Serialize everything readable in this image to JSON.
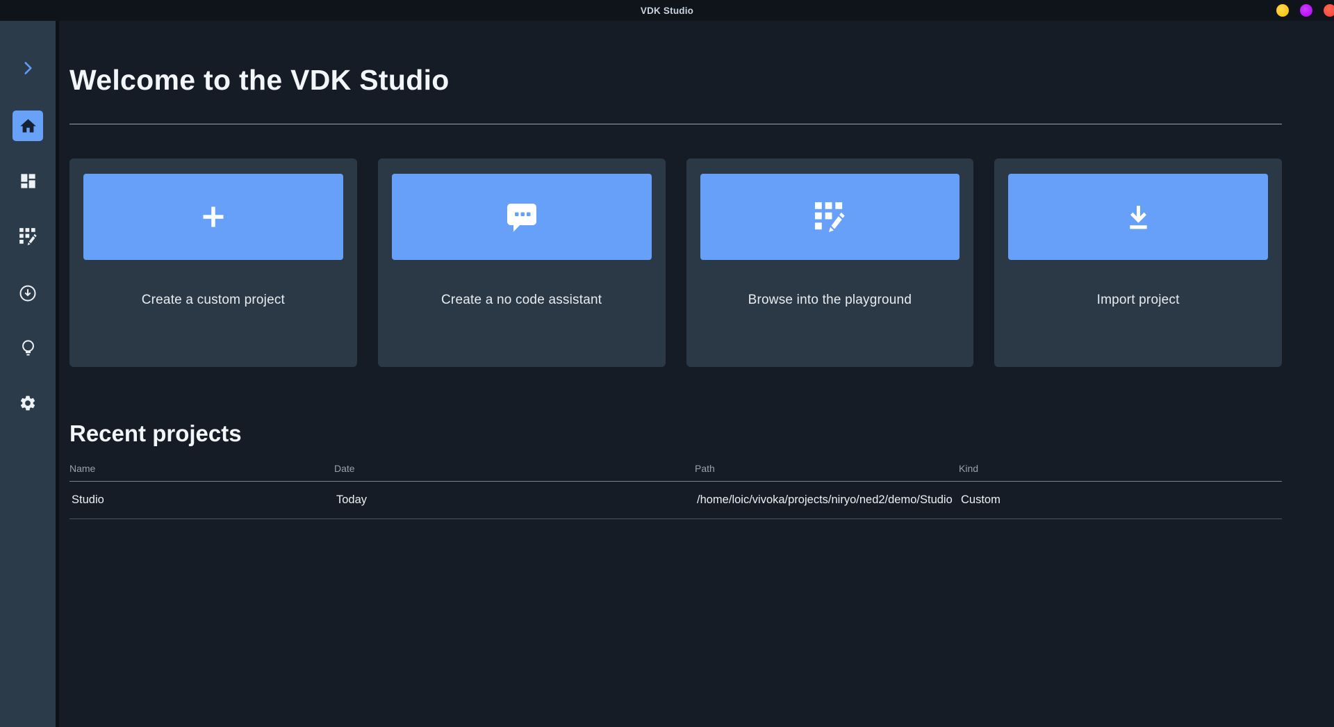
{
  "titlebar": {
    "title": "VDK Studio",
    "window_dot_colors": {
      "minimize": "#fcbe00",
      "maximize": "#ae00f2",
      "close": "#fb3a3d"
    }
  },
  "sidebar": {
    "items": [
      {
        "id": "expand",
        "icon": "chevron-right-icon",
        "active": false
      },
      {
        "id": "home",
        "icon": "home-icon",
        "active": true
      },
      {
        "id": "dashboard",
        "icon": "dashboard-icon",
        "active": false
      },
      {
        "id": "playground",
        "icon": "grid-edit-icon",
        "active": false
      },
      {
        "id": "import",
        "icon": "download-circle-icon",
        "active": false
      },
      {
        "id": "ideas",
        "icon": "lightbulb-icon",
        "active": false
      },
      {
        "id": "settings",
        "icon": "gear-icon",
        "active": false
      }
    ]
  },
  "main": {
    "heading": "Welcome to the VDK Studio",
    "cards": [
      {
        "label": "Create a custom project",
        "icon": "plus-icon"
      },
      {
        "label": "Create a no code assistant",
        "icon": "chat-icon"
      },
      {
        "label": "Browse into the playground",
        "icon": "grid-edit-icon"
      },
      {
        "label": "Import project",
        "icon": "download-icon"
      }
    ],
    "recent": {
      "heading": "Recent projects",
      "columns": [
        "Name",
        "Date",
        "Path",
        "Kind"
      ],
      "rows": [
        {
          "name": "Studio",
          "date": "Today",
          "path": "/home/loic/vivoka/projects/niryo/ned2/demo/Studio",
          "kind": "Custom"
        }
      ]
    }
  },
  "colors": {
    "accent_blue": "#66a0f9",
    "sidebar_bg": "#2c3b4a",
    "content_bg": "#151c26",
    "card_bg": "#2b3947",
    "titlebar_bg": "#0f141b"
  }
}
